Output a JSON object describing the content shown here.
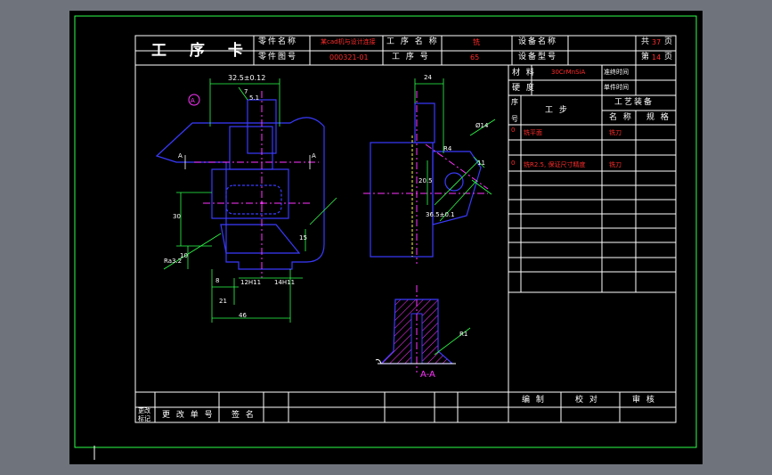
{
  "card": {
    "title": "工 序 卡",
    "part_name_label": "零件名称",
    "part_name_value": "某cad机与设计连接",
    "process_name_label": "工 序 名 称",
    "process_name_value": "铣",
    "equipment_name_label": "设备名称",
    "total_label": "共",
    "total_value": "37",
    "total_unit": "页",
    "part_no_label": "零件图号",
    "part_no_value": "000321-01",
    "process_no_label": "工 序 号",
    "process_no_value": "65",
    "equipment_model_label": "设备型号",
    "page_label": "第",
    "page_value": "14",
    "page_unit": "页",
    "material_label": "材 料",
    "material_value": "30CrMnSiA",
    "prep_time_label": "准终时间",
    "hardness_label": "硬 度",
    "unit_time_label": "单件时间",
    "seq_label_1": "序",
    "seq_label_2": "号",
    "step_label": "工 步",
    "equip_label": "工艺装备",
    "equip_name_label": "名 称",
    "equip_spec_label": "规 格",
    "steps": [
      {
        "seq": "0",
        "desc": "铣平面",
        "tool": "铣刀"
      },
      {
        "seq": "0",
        "desc": "铣R2.5, 保证尺寸精度",
        "tool": "铣刀"
      }
    ],
    "editor_label": "编 制",
    "checker_label": "校 对",
    "approver_label": "审 核",
    "change_mark_label_1": "更改",
    "change_mark_label_2": "标记",
    "change_doc_label": "更 改 单 号",
    "sign_label": "签 名"
  },
  "drawing": {
    "dim_top": "32.5±0.12",
    "dim_24": "24",
    "dim_7": "7",
    "dim_5": "5.1",
    "dim_30": "30",
    "dim_10": "10",
    "dim_8": "8",
    "dim_21": "21",
    "dim_46": "46",
    "dim_15": "15",
    "dim_12h": "12H11",
    "dim_14h": "14H11",
    "dim_11": "11",
    "dim_20_5": "20.5",
    "dim_36": "36.5±0.1",
    "dim_r4": "R4",
    "dim_phi": "Ø14",
    "dim_r": "R1",
    "label_a": "A",
    "section_label": "A-A",
    "surface_mark": "Ra3.2"
  },
  "colors": {
    "frame_green": "#2dff4a",
    "cad_blue": "#3a3aff",
    "cad_magenta": "#ff33ff",
    "cad_yellow": "#ffff33",
    "cad_red": "#ff2b2b"
  }
}
